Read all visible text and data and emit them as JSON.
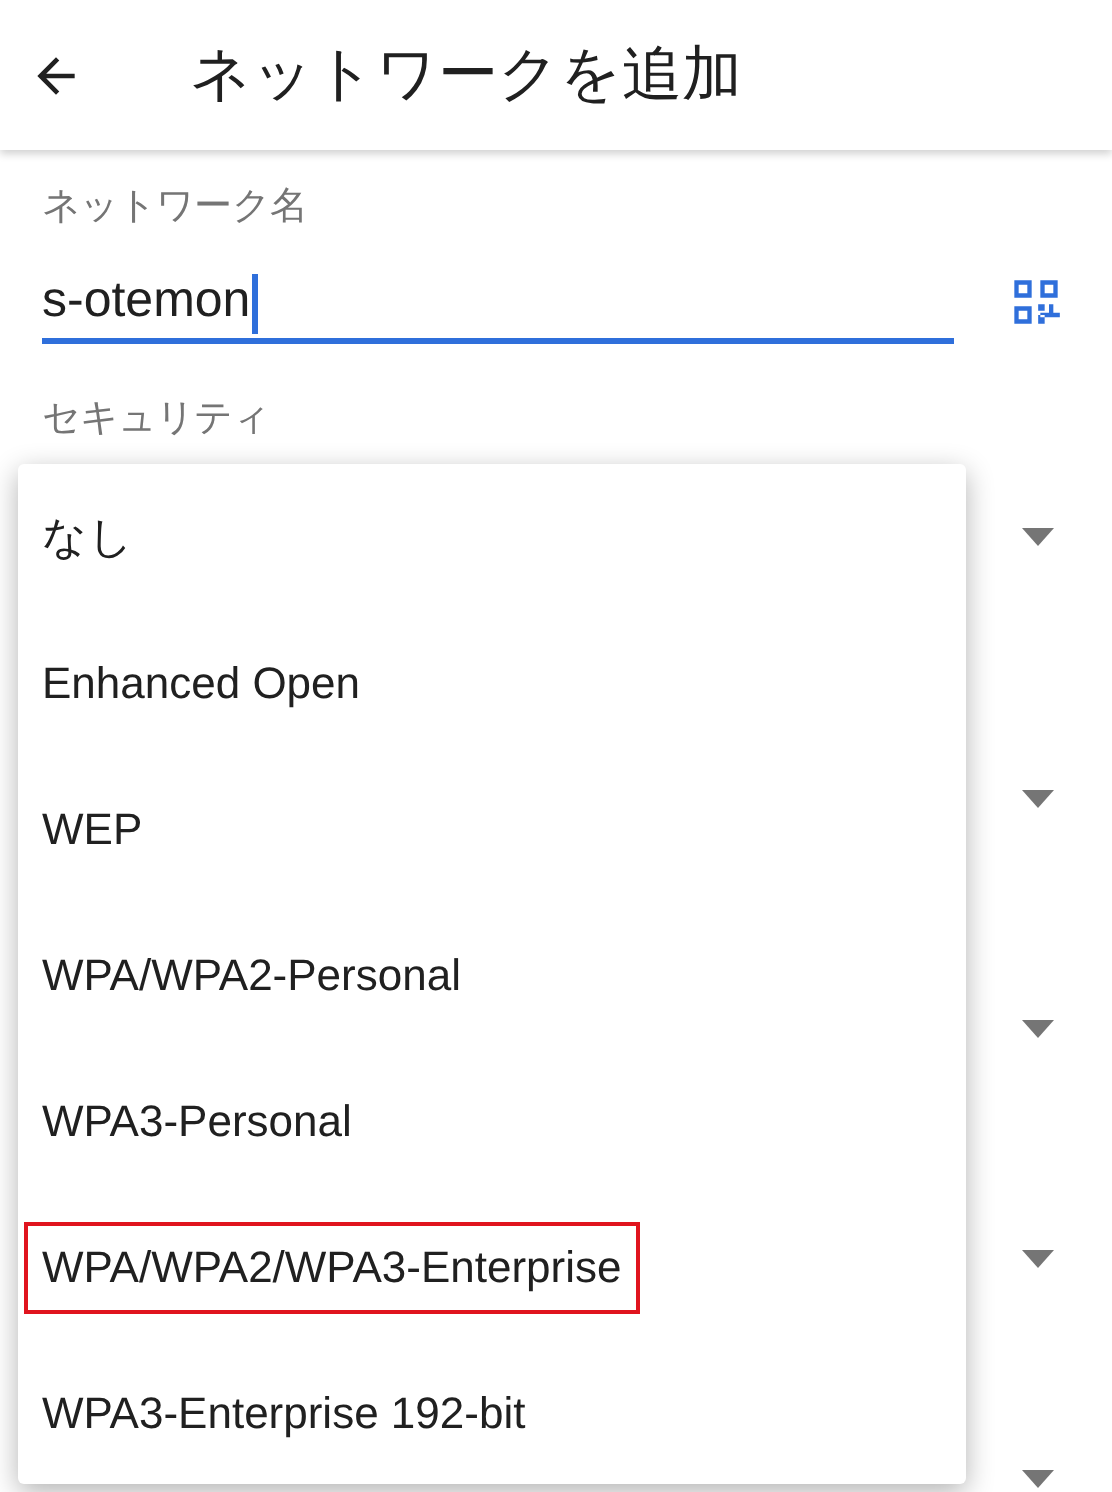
{
  "app_bar": {
    "title": "ネットワークを追加"
  },
  "network_name": {
    "label": "ネットワーク名",
    "value": "s-otemon",
    "focused": true
  },
  "security": {
    "label": "セキュリティ"
  },
  "background_fields": [
    {
      "kind": "dropdown"
    },
    {
      "kind": "dropdown"
    },
    {
      "kind": "dropdown"
    },
    {
      "kind": "dropdown"
    },
    {
      "kind": "dropdown"
    }
  ],
  "security_menu": {
    "options": [
      {
        "label": "なし",
        "highlighted": false
      },
      {
        "label": "Enhanced Open",
        "highlighted": false
      },
      {
        "label": "WEP",
        "highlighted": false
      },
      {
        "label": "WPA/WPA2-Personal",
        "highlighted": false
      },
      {
        "label": "WPA3-Personal",
        "highlighted": false
      },
      {
        "label": "WPA/WPA2/WPA3-Enterprise",
        "highlighted": true
      },
      {
        "label": "WPA3-Enterprise 192-bit",
        "highlighted": false
      }
    ]
  }
}
